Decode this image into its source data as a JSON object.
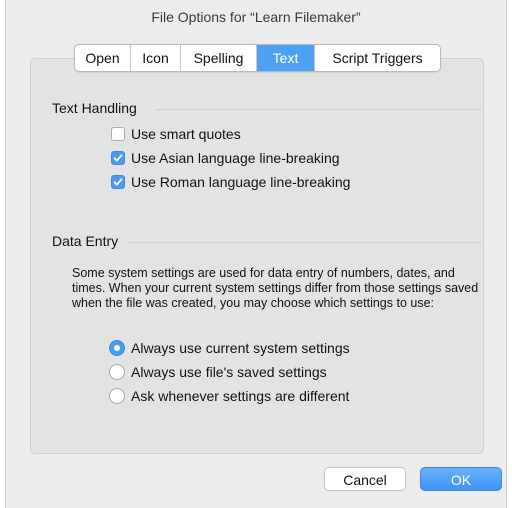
{
  "window": {
    "title": "File Options for “Learn Filemaker”"
  },
  "tabs": [
    {
      "label": "Open",
      "selected": false
    },
    {
      "label": "Icon",
      "selected": false
    },
    {
      "label": "Spelling",
      "selected": false
    },
    {
      "label": "Text",
      "selected": true
    },
    {
      "label": "Script Triggers",
      "selected": false
    }
  ],
  "text_handling": {
    "title": "Text Handling",
    "options": [
      {
        "label": "Use smart quotes",
        "checked": false
      },
      {
        "label": "Use Asian language line-breaking",
        "checked": true
      },
      {
        "label": "Use Roman language line-breaking",
        "checked": true
      }
    ]
  },
  "data_entry": {
    "title": "Data Entry",
    "description": "Some system settings are used for data entry of numbers, dates, and times.  When your current system settings differ from those settings saved when the file was created, you may choose which settings to use:",
    "options": [
      {
        "label": "Always use current system settings",
        "selected": true
      },
      {
        "label": "Always use file's saved settings",
        "selected": false
      },
      {
        "label": "Ask whenever settings are different",
        "selected": false
      }
    ]
  },
  "buttons": {
    "cancel": "Cancel",
    "ok": "OK"
  },
  "colors": {
    "accent": "#4a9bf3",
    "window_bg": "#ececec",
    "panel_bg": "#e3e3e3"
  }
}
